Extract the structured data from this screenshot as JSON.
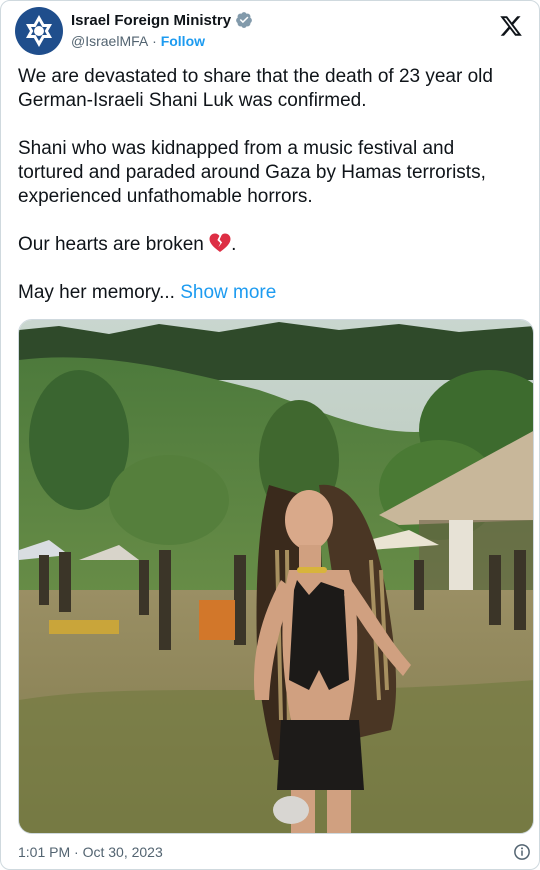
{
  "author": {
    "display_name": "Israel Foreign Ministry",
    "handle": "@IsraelMFA",
    "separator": " · ",
    "follow_label": "Follow",
    "verified_icon": "verified-badge-icon",
    "avatar_icon": "star-of-david-logo"
  },
  "platform_icon": "x-logo-icon",
  "tweet": {
    "paragraph_1": "We are devastated to share that the death of 23 year old German-Israeli Shani Luk was confirmed.",
    "paragraph_2": "Shani who was kidnapped from a music festival and tortured and paraded around Gaza by Hamas terrorists, experienced unfathomable horrors.",
    "paragraph_3_text": "Our hearts are broken ",
    "paragraph_3_emoji": "broken-heart-emoji",
    "paragraph_3_end": ".",
    "paragraph_4_text": "May her memory... ",
    "show_more_label": "Show more"
  },
  "media": {
    "description_icon": "photo"
  },
  "footer": {
    "timestamp": "1:01 PM · Oct 30, 2023",
    "info_icon": "info-icon"
  },
  "colors": {
    "link": "#1d9bf0",
    "text": "#0f1419",
    "secondary": "#536471",
    "border": "#cfd9de",
    "verified": "#829aab"
  }
}
